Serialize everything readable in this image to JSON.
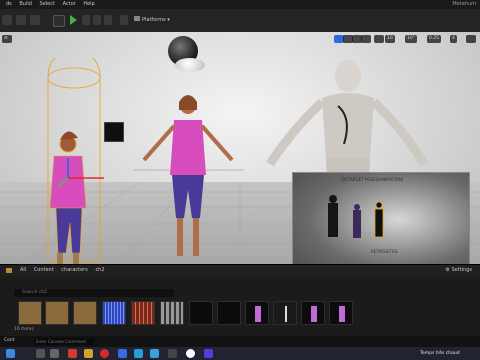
{
  "menubar": {
    "items": [
      "ds",
      "Build",
      "Select",
      "Actor",
      "Help"
    ],
    "project_title": "Metahum"
  },
  "toolbar": {
    "platforms_label": "Platforms"
  },
  "viewport": {
    "snap_values": [
      "10",
      "10°",
      "0.25"
    ],
    "camera_speed": "4",
    "preview_title": "(RETARGET POSES/ANIMATION)",
    "preview_caption": "RETARGETED"
  },
  "content_browser": {
    "path": [
      "All",
      "Content",
      "characters",
      "ch2"
    ],
    "settings_label": "Settings",
    "search_placeholder": "Search ch2",
    "item_count": "16 items"
  },
  "bottom": {
    "content_drawer_label": "Cont",
    "cmd_placeholder": "Enter Console Command"
  },
  "taskbar": {
    "notification": "Temps très chaud"
  },
  "colors": {
    "accent_green": "#3fb24a",
    "selection_orange": "#e8a020",
    "gizmo_red": "#e0282e",
    "gizmo_green": "#4ac04a",
    "gizmo_blue": "#2a6adf"
  }
}
